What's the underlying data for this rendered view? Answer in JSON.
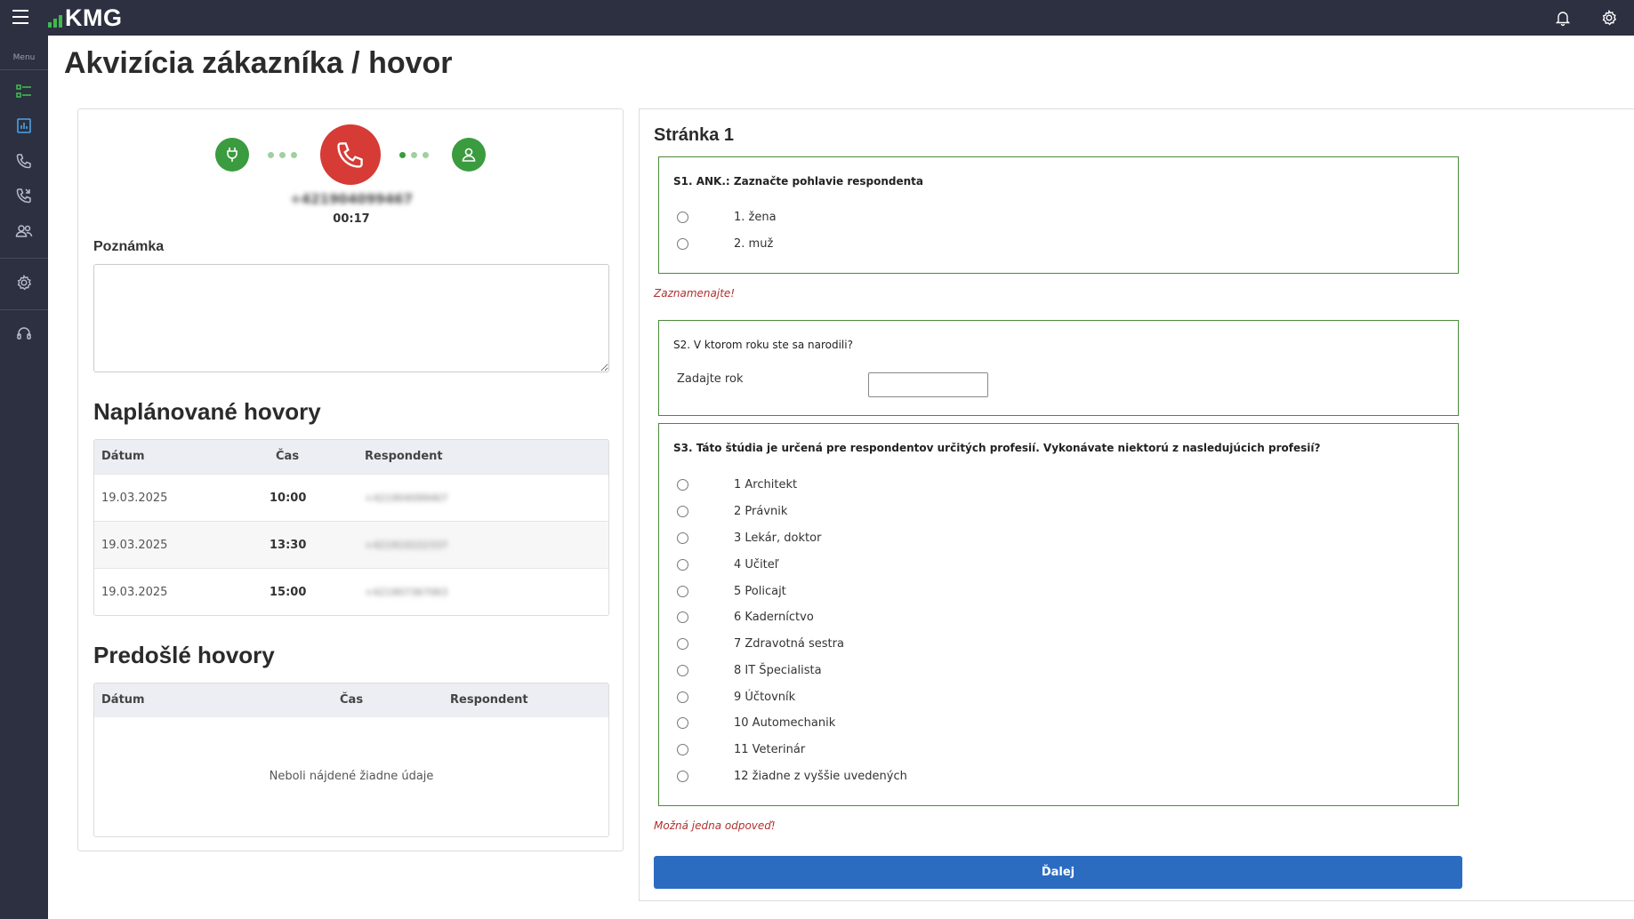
{
  "app": {
    "logo_text": "KMG"
  },
  "sidebar": {
    "menu_label": "Menu"
  },
  "page": {
    "title": "Akvizícia zákazníka / hovor"
  },
  "call": {
    "phone_number": "+421904099467",
    "duration": "00:17",
    "colors": {
      "green": "#3a9b3f",
      "red": "#d63b36"
    }
  },
  "note": {
    "label": "Poznámka",
    "value": ""
  },
  "scheduled": {
    "title": "Naplánované hovory",
    "columns": [
      "Dátum",
      "Čas",
      "Respondent"
    ],
    "rows": [
      {
        "date": "19.03.2025",
        "time": "10:00",
        "respondent": "+421904099467"
      },
      {
        "date": "19.03.2025",
        "time": "13:30",
        "respondent": "+421910222337"
      },
      {
        "date": "19.03.2025",
        "time": "15:00",
        "respondent": "+421907367063"
      }
    ]
  },
  "previous": {
    "title": "Predošlé hovory",
    "columns": [
      "Dátum",
      "Čas",
      "Respondent"
    ],
    "empty_text": "Neboli nájdené žiadne údaje"
  },
  "survey": {
    "page_title": "Stránka 1",
    "q1": {
      "title": "S1. ANK.: Zaznačte pohlavie respondenta",
      "options": [
        "1. žena",
        "2. muž"
      ],
      "error": "Zaznamenajte!"
    },
    "q2": {
      "title": "S2. V ktorom roku ste sa narodili?",
      "input_label": "Zadajte rok",
      "input_value": ""
    },
    "q3": {
      "title": "S3.  Táto štúdia je určená pre respondentov určitých profesií. Vykonávate niektorú z nasledujúcich profesií?",
      "options": [
        "1 Architekt",
        "2 Právnik",
        "3 Lekár, doktor",
        "4 Učiteľ",
        "5 Policajt",
        "6 Kaderníctvo",
        "7 Zdravotná sestra",
        "8 IT Špecialista",
        "9 Účtovník",
        "10 Automechanik",
        "11 Veterinár",
        "12 žiadne z vyššie uvedených"
      ],
      "error": "Možná jedna odpoveď!"
    },
    "next_label": "Ďalej"
  }
}
